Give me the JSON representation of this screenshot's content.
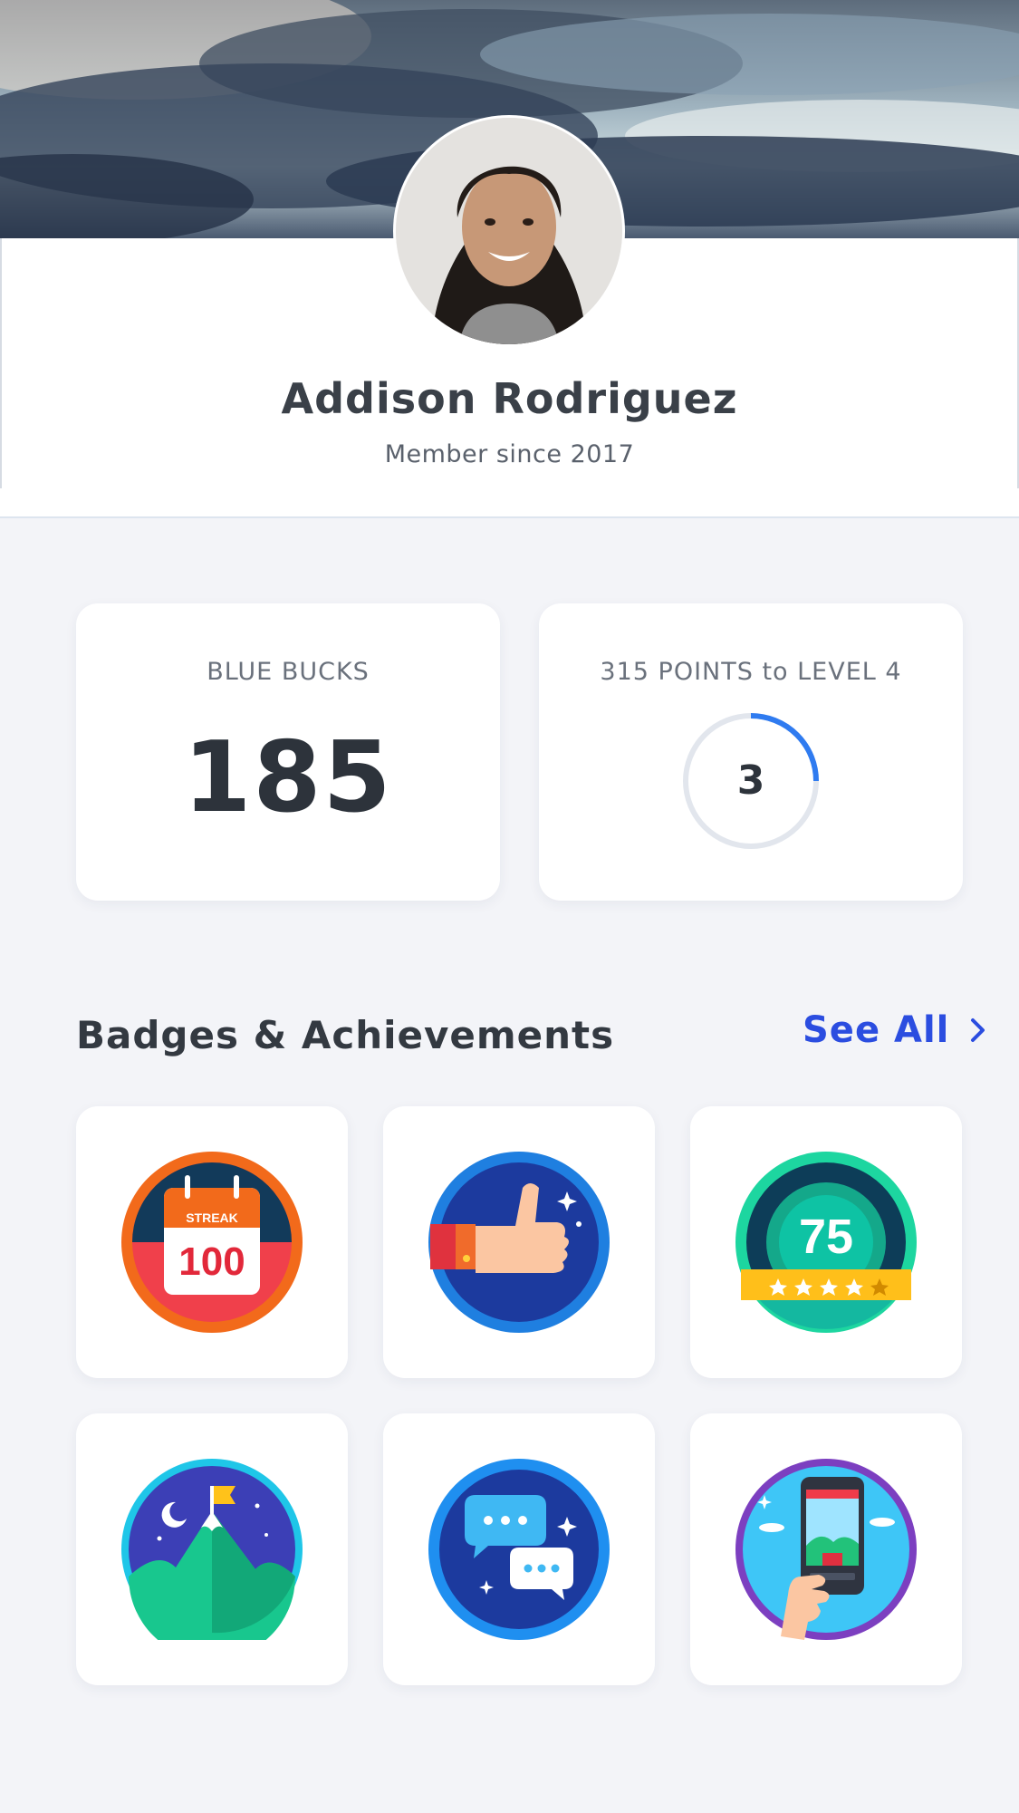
{
  "profile": {
    "name": "Addison Rodriguez",
    "member_since": "Member since 2017"
  },
  "stats": {
    "blue_bucks": {
      "label": "BLUE BUCKS",
      "value": "185"
    },
    "level": {
      "label": "315 POINTS  to LEVEL 4",
      "current_level": "3",
      "progress_fraction": 0.25
    }
  },
  "badges_section": {
    "title": "Badges & Achievements",
    "see_all_label": "See All",
    "badges": [
      {
        "icon": "streak-calendar-icon",
        "text": "STREAK",
        "number": "100"
      },
      {
        "icon": "thumbs-up-icon"
      },
      {
        "icon": "rating-75-icon",
        "number": "75"
      },
      {
        "icon": "mountain-peak-icon"
      },
      {
        "icon": "chat-bubbles-icon"
      },
      {
        "icon": "phone-in-hand-icon"
      }
    ]
  },
  "colors": {
    "accent": "#2b4de0",
    "ring_progress": "#2f7bf0",
    "ring_track": "#e2e6ed",
    "background": "#f3f4f8"
  }
}
